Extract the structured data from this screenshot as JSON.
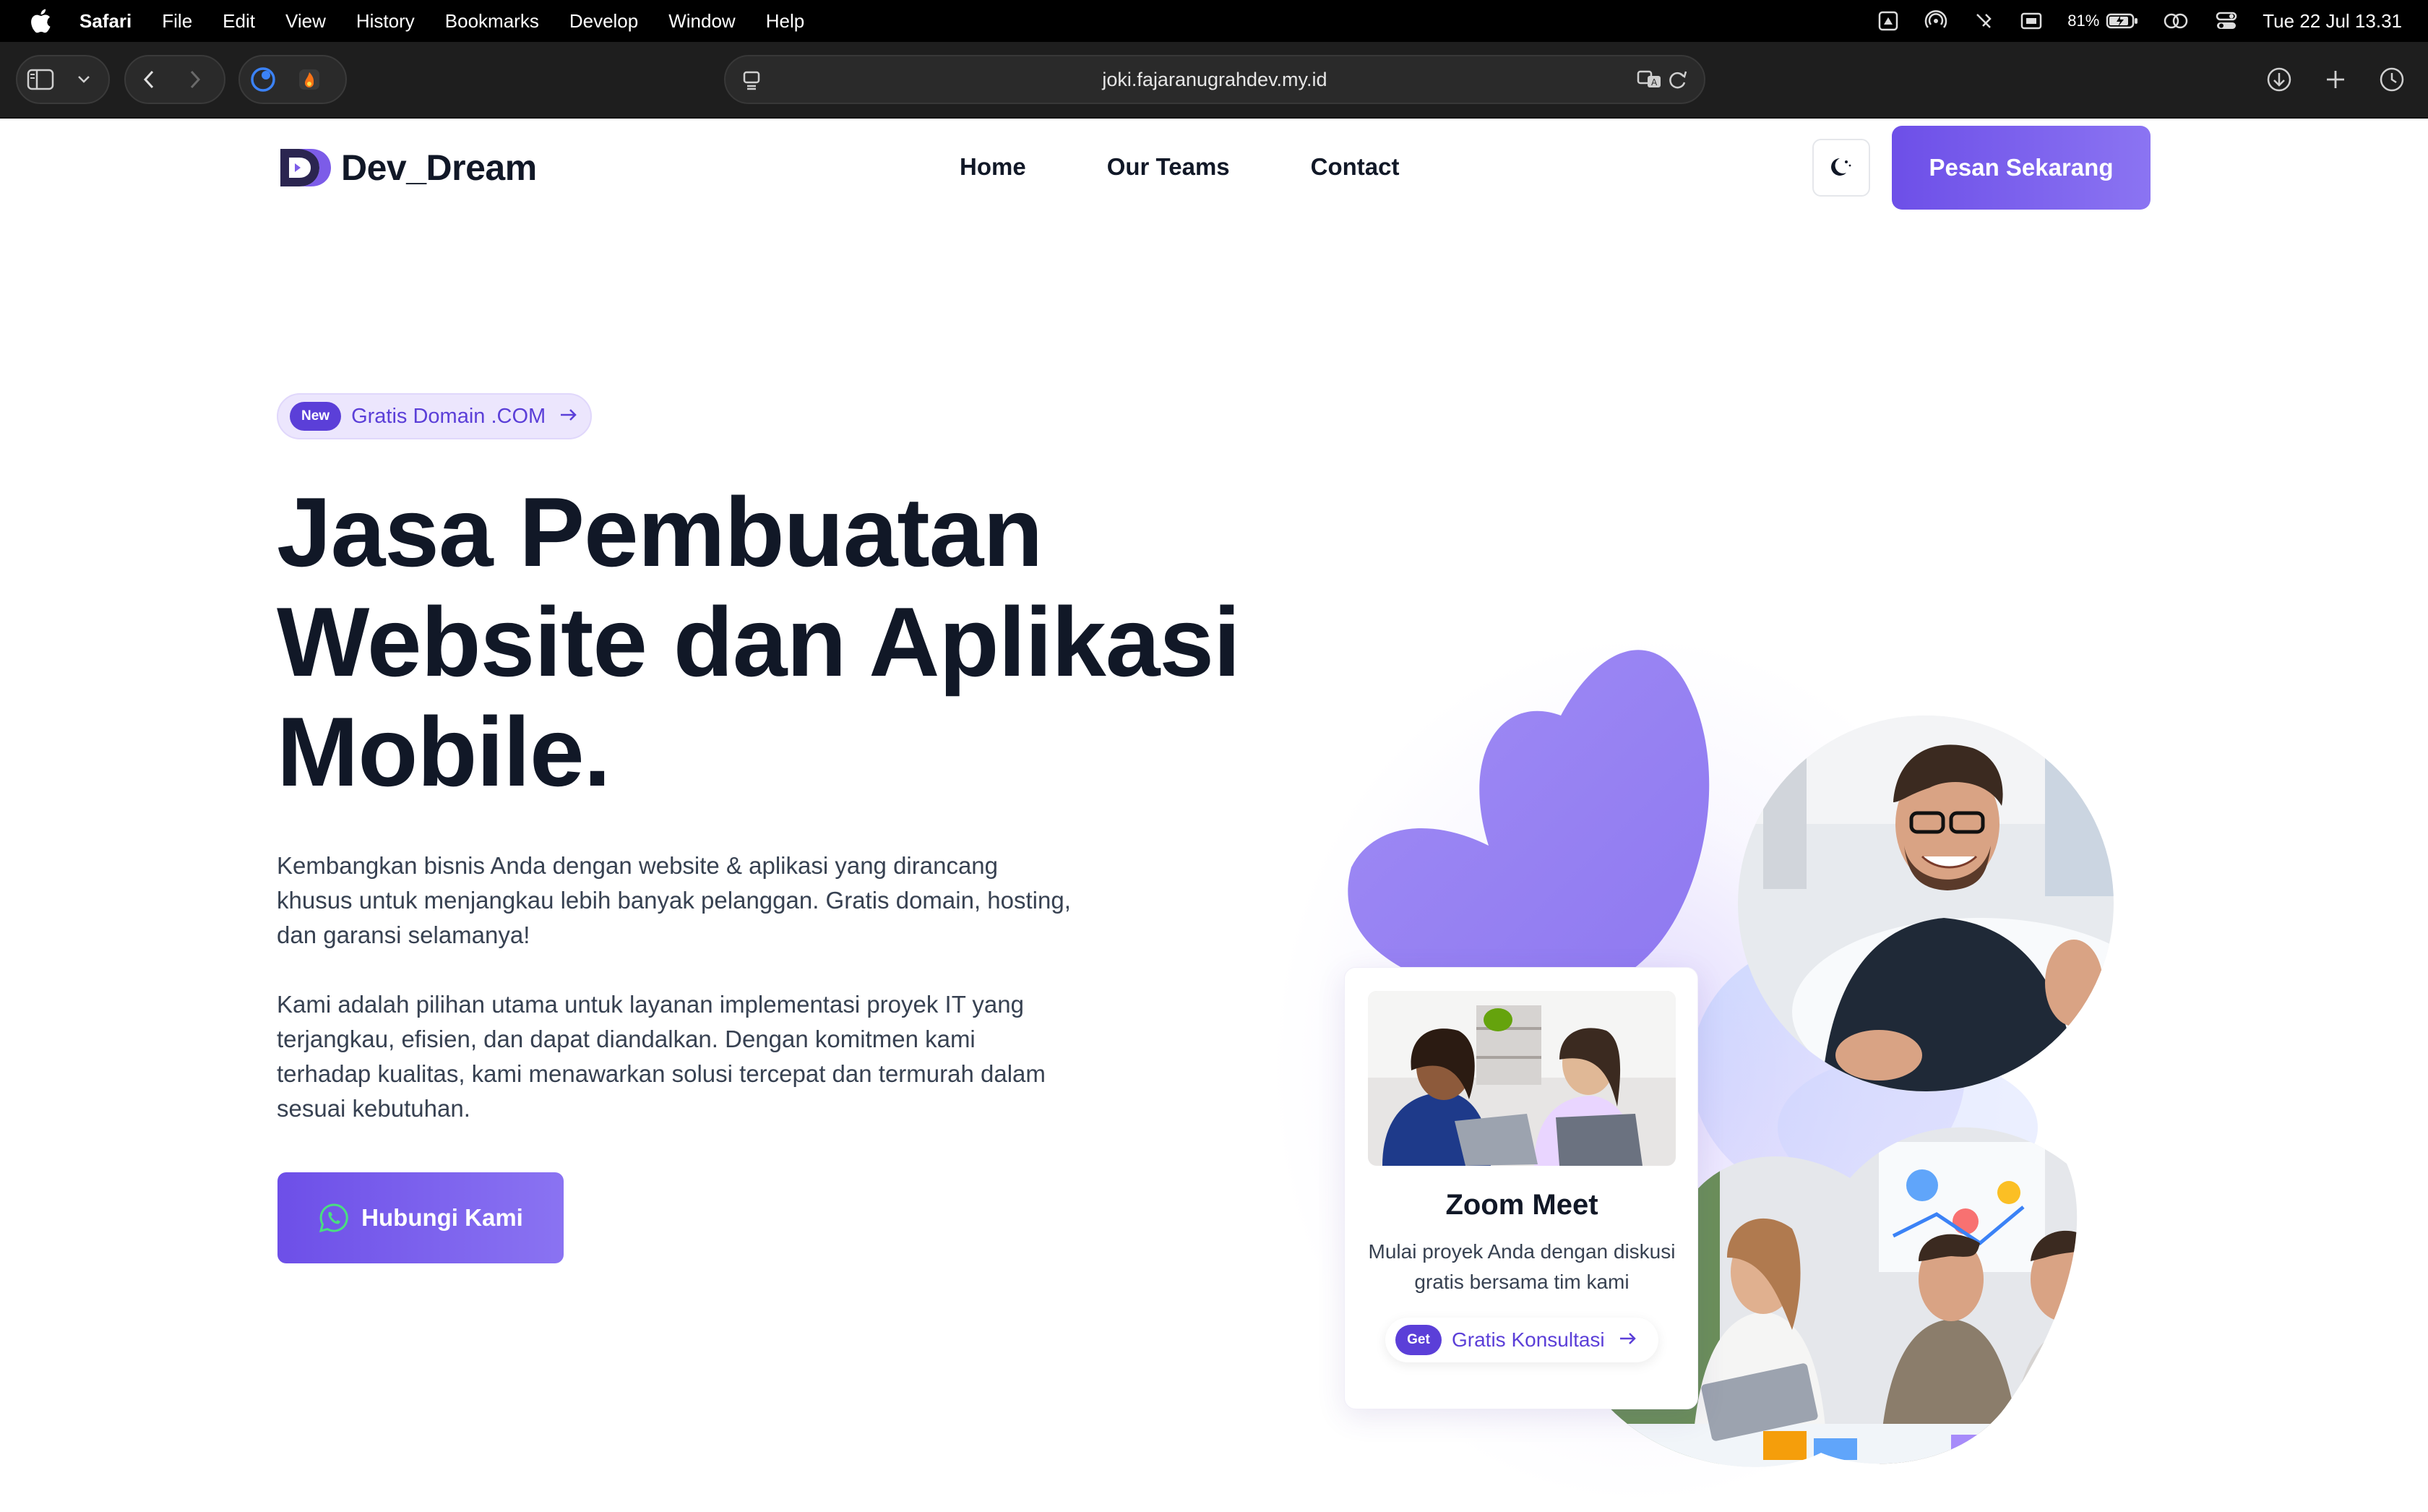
{
  "menubar": {
    "app": "Safari",
    "items": [
      "File",
      "Edit",
      "View",
      "History",
      "Bookmarks",
      "Develop",
      "Window",
      "Help"
    ],
    "battery": "81%",
    "clock": "Tue 22 Jul  13.31"
  },
  "browser": {
    "url": "joki.fajaranugrahdev.my.id"
  },
  "site": {
    "brand": "Dev_Dream",
    "nav": [
      "Home",
      "Our Teams",
      "Contact"
    ],
    "cta": "Pesan Sekarang"
  },
  "hero": {
    "badge_tag": "New",
    "badge_text": "Gratis Domain .COM",
    "title_lines": [
      "Jasa Pembuatan",
      "Website dan Aplikasi",
      "Mobile."
    ],
    "paragraph1": "Kembangkan bisnis Anda dengan website & aplikasi yang dirancang khusus untuk menjangkau lebih banyak pelanggan. Gratis domain, hosting, dan garansi selamanya!",
    "paragraph2": "Kami adalah pilihan utama untuk layanan implementasi proyek IT yang terjangkau, efisien, dan dapat diandalkan. Dengan komitmen kami terhadap kualitas, kami menawarkan solusi tercepat dan termurah dalam sesuai kebutuhan.",
    "button": "Hubungi Kami"
  },
  "card": {
    "title": "Zoom Meet",
    "description": "Mulai proyek Anda dengan diskusi gratis bersama tim kami",
    "tag": "Get",
    "link": "Gratis Konsultasi"
  },
  "colors": {
    "accent": "#6d4fe8",
    "accent_light": "#9b85f5",
    "badge_bg": "#ece6fd",
    "text_dark": "#111827"
  }
}
